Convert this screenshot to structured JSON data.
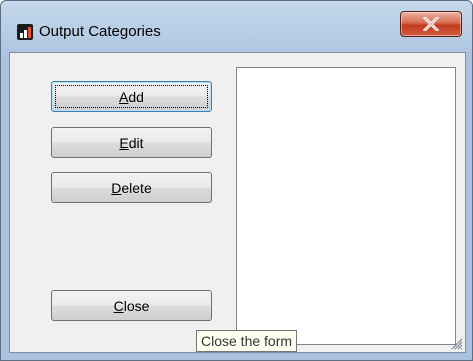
{
  "window": {
    "title": "Output Categories",
    "icon": "bar-chart-icon",
    "close_icon": "close-icon"
  },
  "buttons": {
    "add": {
      "pre": "",
      "mnemonic": "A",
      "post": "dd"
    },
    "edit": {
      "pre": "",
      "mnemonic": "E",
      "post": "dit"
    },
    "delete": {
      "pre": "",
      "mnemonic": "D",
      "post": "elete"
    },
    "close": {
      "pre": "",
      "mnemonic": "C",
      "post": "lose"
    }
  },
  "listbox": {
    "items": []
  },
  "tooltip": {
    "text": "Close the form"
  },
  "colors": {
    "frame": "#b9cfe6",
    "client": "#f0f0f0",
    "close_button": "#c23a1c",
    "tooltip_bg": "#fffff0"
  }
}
